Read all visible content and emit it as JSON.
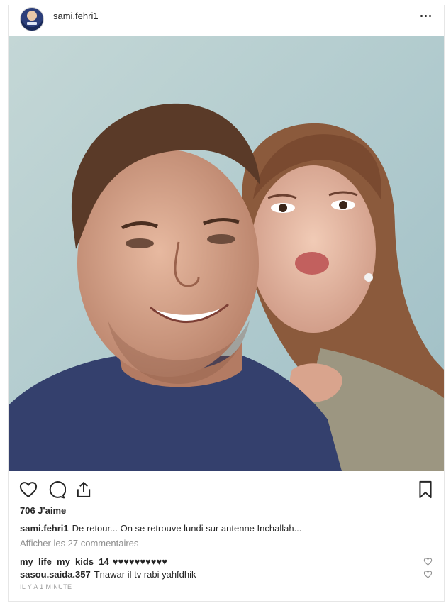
{
  "post": {
    "username": "sami.fehri1",
    "likes": "706 J'aime",
    "caption_user": "sami.fehri1",
    "caption_text": "De retour... On se retrouve lundi sur antenne Inchallah...",
    "view_all_comments": "Afficher les 27 commentaires",
    "comments": [
      {
        "user": "my_life_my_kids_14",
        "text": "♥♥♥♥♥♥♥♥♥♥"
      },
      {
        "user": "sasou.saida.357",
        "text": "Tnawar il tv rabi yahfdhik"
      }
    ],
    "timestamp": "IL Y A 1 MINUTE"
  },
  "icons": {
    "more": "more-options-icon",
    "like": "heart-icon",
    "comment": "comment-bubble-icon",
    "share": "share-icon",
    "save": "bookmark-icon"
  },
  "colors": {
    "text": "#262626",
    "muted": "#8e8e8e",
    "border": "#e6e6e6"
  }
}
